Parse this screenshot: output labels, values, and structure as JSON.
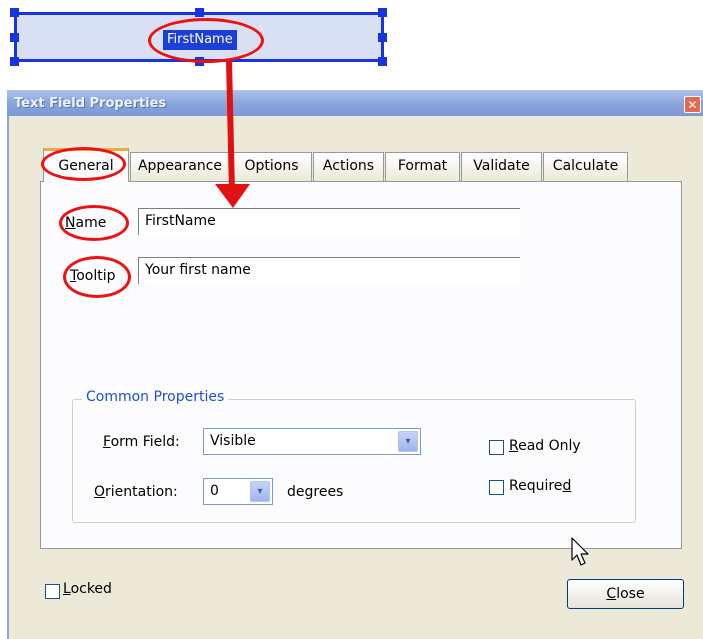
{
  "page_field": {
    "name": "FirstName"
  },
  "dialog": {
    "title": "Text Field Properties",
    "close_glyph": "✕",
    "tabs": [
      "General",
      "Appearance",
      "Options",
      "Actions",
      "Format",
      "Validate",
      "Calculate"
    ],
    "active_tab": "General",
    "name": {
      "label_first": "N",
      "label_rest": "ame",
      "value": "FirstName"
    },
    "tooltip": {
      "label_first": "T",
      "label_rest": "ooltip",
      "value": "Your first name"
    },
    "common_properties": {
      "title": "Common Properties",
      "form_field": {
        "label_first": "F",
        "label_rest": "orm Field:",
        "value": "Visible"
      },
      "orientation": {
        "label_first": "O",
        "label_rest": "rientation:",
        "value": "0",
        "unit": "degrees"
      },
      "read_only": {
        "label_first": "R",
        "label_rest": "ead Only",
        "checked": false
      },
      "required": {
        "label_pre": "Require",
        "label_under": "d",
        "checked": false
      }
    },
    "locked": {
      "label_first": "L",
      "label_rest": "ocked",
      "checked": false
    },
    "close_button": {
      "label_first": "C",
      "label_rest": "lose"
    }
  },
  "icons": {
    "dropdown_arrow": "▾",
    "cursor": "arrow-cursor-icon"
  },
  "colors": {
    "annotation_red": "#e11111",
    "selection_blue": "#1a33e0",
    "group_title_blue": "#1f4fd1"
  }
}
